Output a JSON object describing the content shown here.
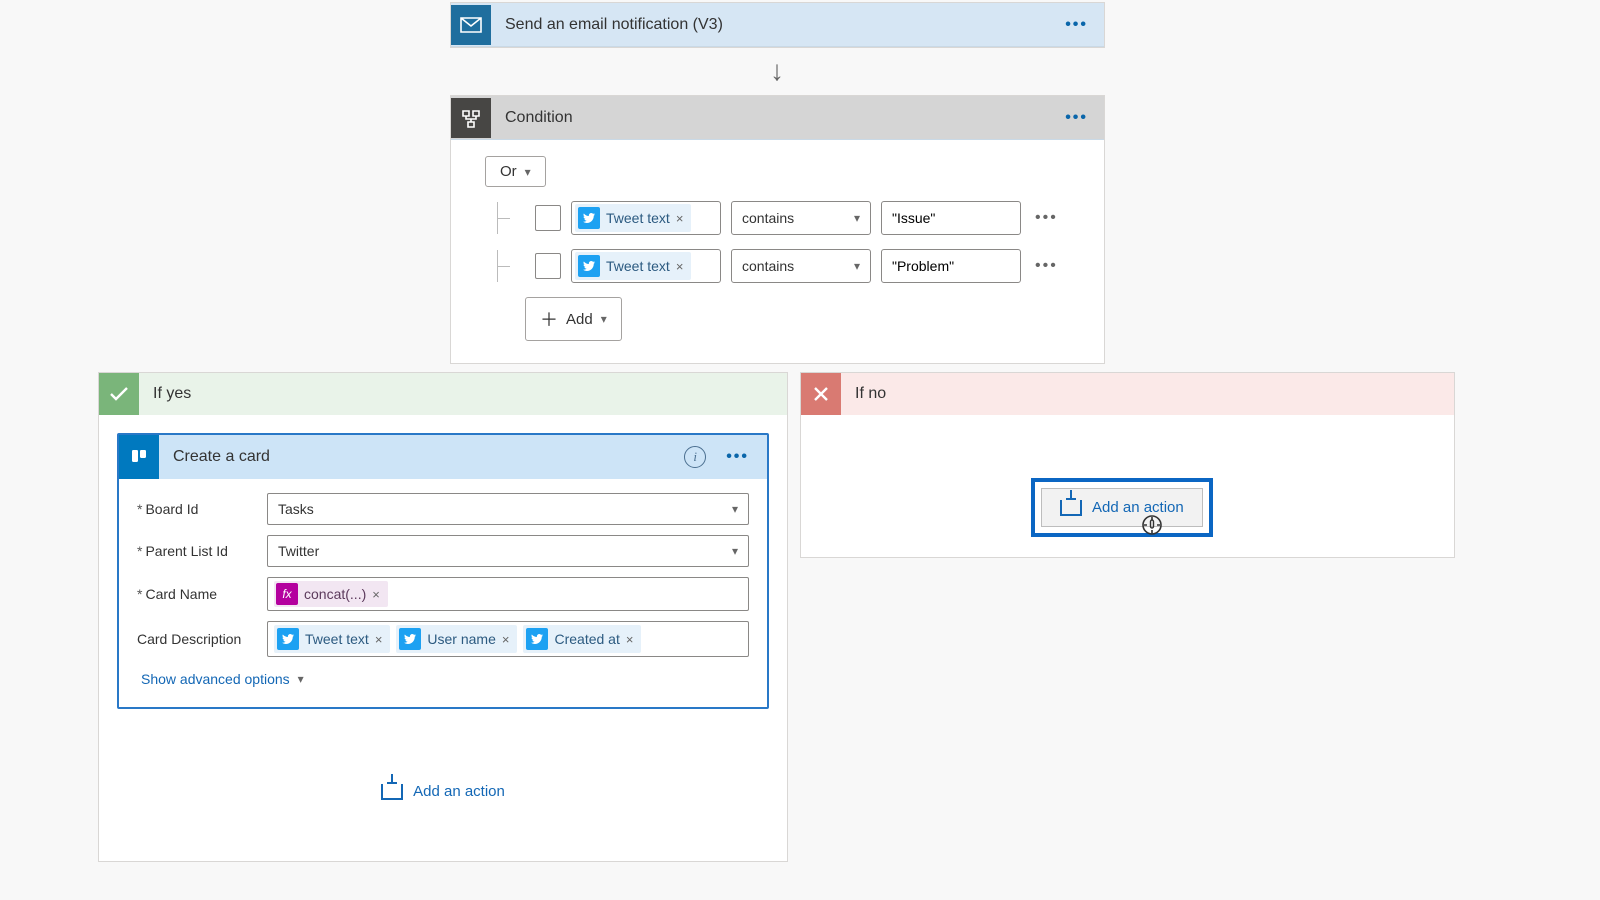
{
  "email_step": {
    "title": "Send an email notification (V3)"
  },
  "condition": {
    "title": "Condition",
    "logic": "Or",
    "rules": [
      {
        "token": "Tweet text",
        "op": "contains",
        "value": "\"Issue\""
      },
      {
        "token": "Tweet text",
        "op": "contains",
        "value": "\"Problem\""
      }
    ],
    "add": "Add"
  },
  "yes_branch": {
    "label": "If yes",
    "card": {
      "title": "Create a card",
      "fields": {
        "board_label": "Board Id",
        "board_value": "Tasks",
        "list_label": "Parent List Id",
        "list_value": "Twitter",
        "name_label": "Card Name",
        "name_token": "concat(...)",
        "desc_label": "Card Description",
        "desc_tokens": [
          "Tweet text",
          "User name",
          "Created at"
        ]
      },
      "advanced": "Show advanced options"
    },
    "add_action": "Add an action"
  },
  "no_branch": {
    "label": "If no",
    "add_action": "Add an action"
  }
}
